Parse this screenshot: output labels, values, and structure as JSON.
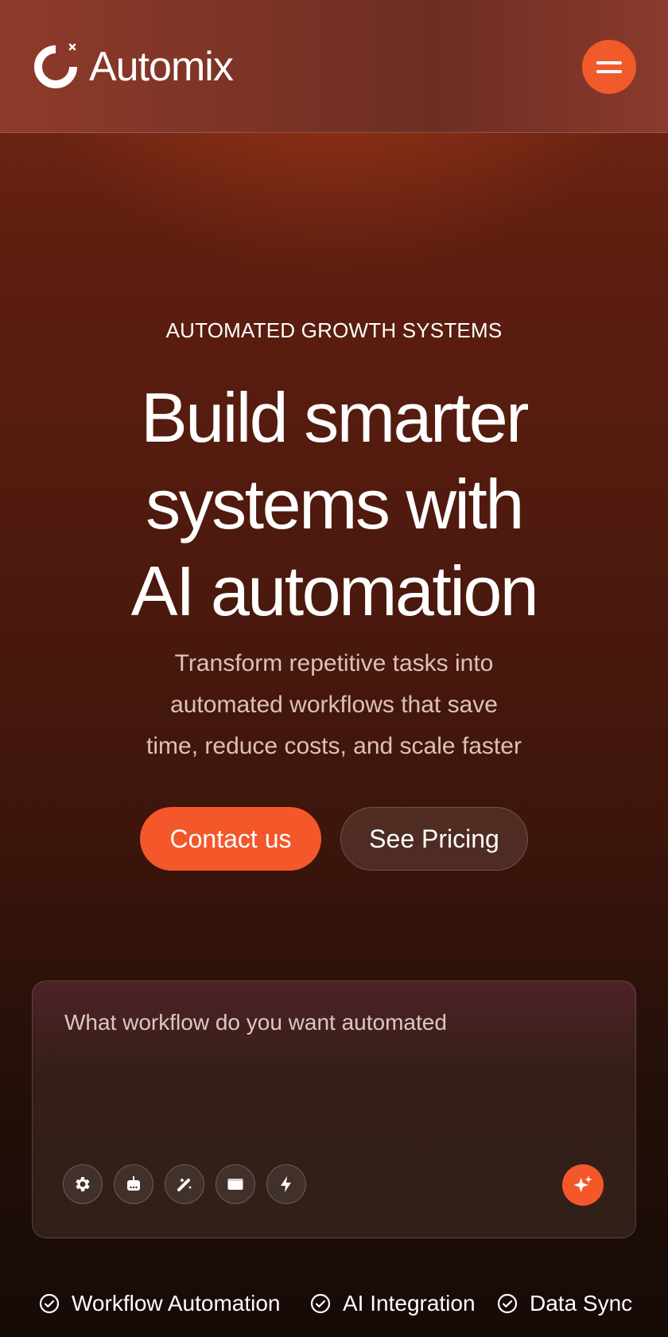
{
  "brand": {
    "name": "Automix",
    "accent_color": "#f4572a",
    "logo_icon": "ring-logo-icon"
  },
  "header": {
    "menu_icon": "hamburger-menu-icon"
  },
  "hero": {
    "eyebrow": "AUTOMATED GROWTH SYSTEMS",
    "headline_lines": [
      "Build smarter",
      "systems with",
      "AI automation"
    ],
    "subcopy_lines": [
      "Transform repetitive tasks into",
      "automated workflows that save",
      "time, reduce costs, and scale faster"
    ],
    "buttons": {
      "primary": "Contact us",
      "secondary": "See Pricing"
    }
  },
  "prompt": {
    "placeholder": "What workflow do you want automated",
    "tools": [
      "gear-icon",
      "robot-icon",
      "wand-icon",
      "window-icon",
      "bolt-icon"
    ],
    "send_icon": "sparkle-icon"
  },
  "features": [
    "Workflow Automation",
    "AI Integration",
    "Data Sync"
  ]
}
